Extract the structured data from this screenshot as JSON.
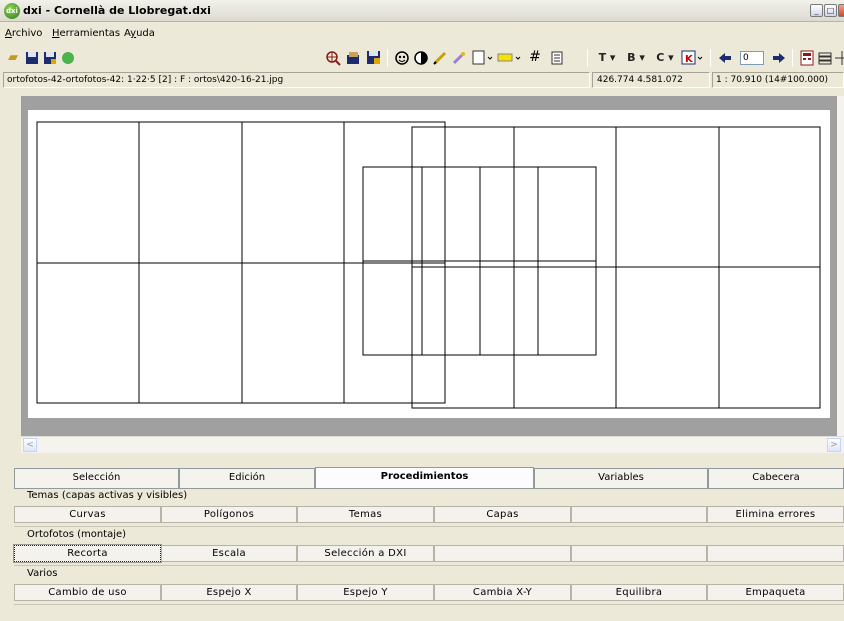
{
  "window": {
    "title": "dxi - Cornellà de Llobregat.dxi",
    "icon_text": "dxi"
  },
  "menu": [
    {
      "label": "Archivo",
      "accel": "A",
      "rest": "rchivo"
    },
    {
      "label": "Herramientas",
      "accel": "H",
      "rest": "erramientas"
    },
    {
      "label": "Ayuda",
      "accel": "y",
      "pre": "A",
      "rest": "uda"
    }
  ],
  "toolbar": {
    "text_buttons": {
      "t": "T ▾",
      "b": "B ▾",
      "c": "C ▾"
    },
    "zoom_value": "0"
  },
  "status": {
    "file": "ortofotos-42-ortofotos-42: 1·22·5 [2] : F : ortos\\420-16-21.jpg",
    "coords": "426.774  4.581.072",
    "scale": "1 : 70.910 (14#100.000)"
  },
  "tabs": [
    "Selección",
    "Edición",
    "Procedimientos",
    "Variables",
    "Cabecera"
  ],
  "active_tab": "Procedimientos",
  "groups": {
    "temas": {
      "label": "Temas (capas activas y visibles)",
      "buttons": [
        "Curvas",
        "Polígonos",
        "Temas",
        "Capas",
        "",
        "Elimina errores"
      ]
    },
    "ortofotos": {
      "label": "Ortofotos (montaje)",
      "buttons": [
        "Recorta",
        "Escala",
        "Selección a DXI",
        "",
        "",
        ""
      ]
    },
    "varios": {
      "label": "Varios",
      "buttons": [
        "Cambio de uso",
        "Espejo X",
        "Espejo Y",
        "Cambia X-Y",
        "Equilibra",
        "Empaqueta"
      ]
    }
  },
  "icons": [
    "open-folder-icon",
    "save-icon",
    "save-as-icon",
    "green-ball-icon",
    "zoom-icon",
    "layers-icon",
    "save-layer-icon",
    "eye-icon",
    "contrast-icon",
    "pencil-icon",
    "paint-icon",
    "page-icon",
    "color-icon",
    "grid-icon",
    "doc-icon",
    "arrow-left-icon",
    "arrow-right-icon",
    "calc-icon",
    "stack-icon",
    "move-icon"
  ]
}
